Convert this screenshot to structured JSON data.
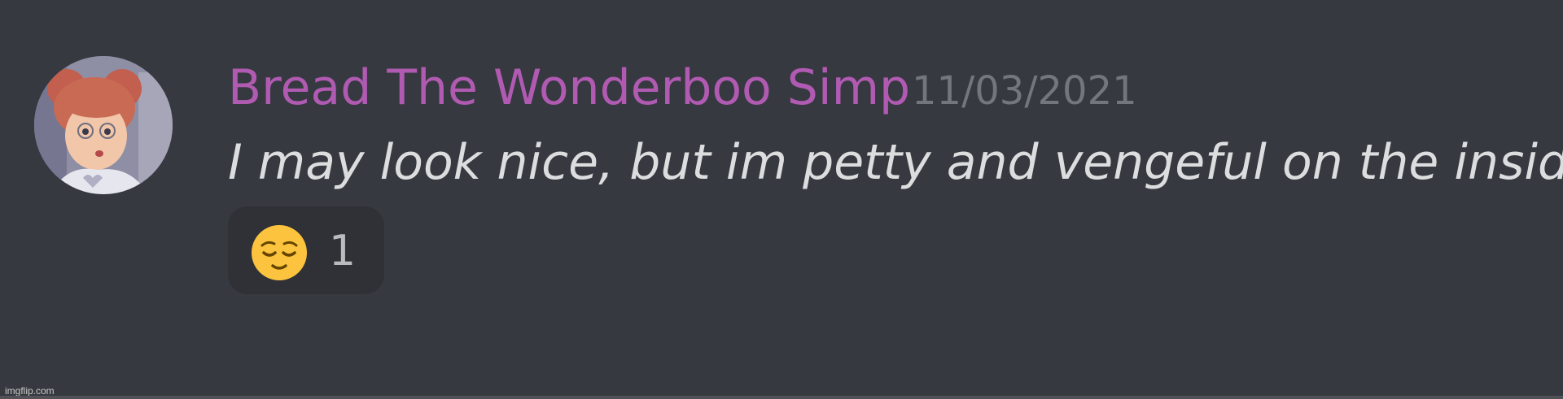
{
  "message": {
    "author": "Bread The Wonderboo Simp",
    "timestamp": "11/03/2021",
    "text": "I may look nice, but im petty and vengeful on the inside",
    "reaction": {
      "emoji_icon": "relieved-face-icon",
      "count": "1"
    }
  },
  "colors": {
    "background": "#36393f",
    "author": "#b05ab2",
    "timestamp": "#72767d",
    "message_text": "#dcddde",
    "reaction_bg": "#2f3136"
  },
  "watermark": "imgflip.com"
}
